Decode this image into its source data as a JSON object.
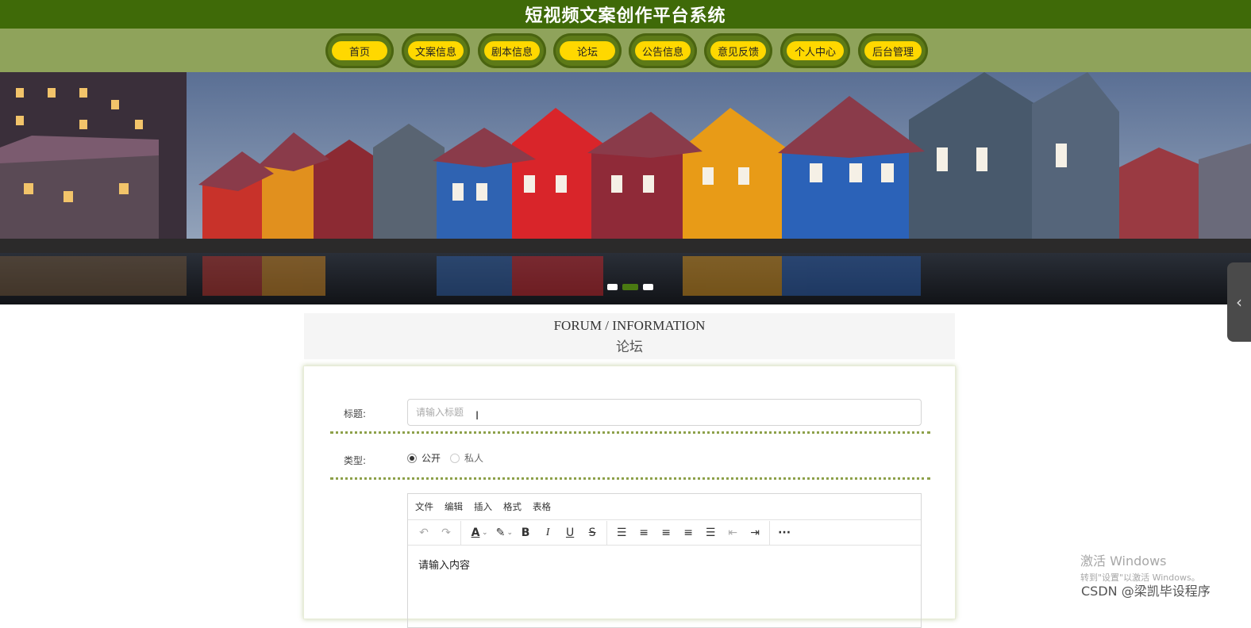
{
  "header": {
    "title": "短视频文案创作平台系统"
  },
  "nav": {
    "items": [
      {
        "label": "首页"
      },
      {
        "label": "文案信息"
      },
      {
        "label": "剧本信息"
      },
      {
        "label": "论坛"
      },
      {
        "label": "公告信息"
      },
      {
        "label": "意见反馈"
      },
      {
        "label": "个人中心"
      },
      {
        "label": "后台管理"
      }
    ]
  },
  "section": {
    "title_en": "FORUM / INFORMATION",
    "title_cn": "论坛"
  },
  "form": {
    "title_label": "标题:",
    "title_placeholder": "请输入标题",
    "type_label": "类型:",
    "type_options": [
      {
        "label": "公开",
        "checked": true
      },
      {
        "label": "私人",
        "checked": false
      }
    ]
  },
  "editor": {
    "menu": [
      "文件",
      "编辑",
      "插入",
      "格式",
      "表格"
    ],
    "placeholder_content": "请输入内容"
  },
  "colors": {
    "topbar": "#3f6a08",
    "navbar": "#8fa35b",
    "nav_pill": "#ffd800"
  },
  "overlay": {
    "watermark_line1": "激活 Windows",
    "watermark_line2": "转到\"设置\"以激活 Windows。",
    "csdn": "CSDN @梁凯毕设程序"
  }
}
